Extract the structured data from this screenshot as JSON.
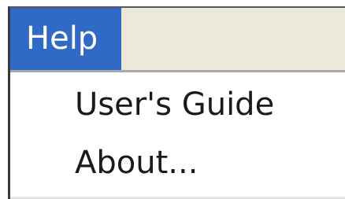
{
  "menubar": {
    "active_menu": "Help",
    "background_color": "#ece9d8",
    "highlight_color": "#3169c6"
  },
  "dropdown": {
    "items": [
      {
        "label": "User's Guide"
      },
      {
        "label": "About..."
      }
    ]
  }
}
